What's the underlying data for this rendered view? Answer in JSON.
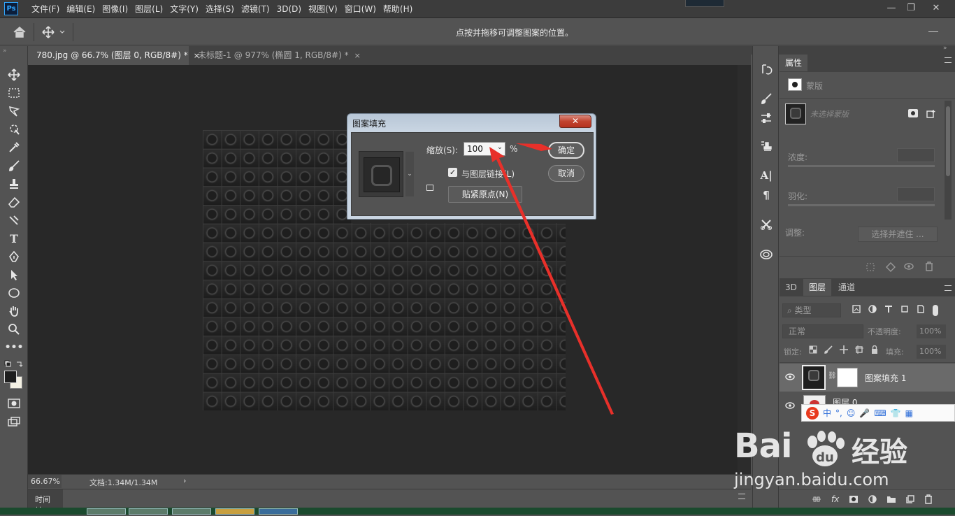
{
  "app": {
    "logo": "Ps"
  },
  "menu": [
    "文件(F)",
    "编辑(E)",
    "图像(I)",
    "图层(L)",
    "文字(Y)",
    "选择(S)",
    "滤镜(T)",
    "3D(D)",
    "视图(V)",
    "窗口(W)",
    "帮助(H)"
  ],
  "window_controls": {
    "minimize": "—",
    "restore": "❐",
    "close": "✕"
  },
  "options_bar": {
    "hint": "点按并拖移可调整图案的位置。"
  },
  "tabs": [
    {
      "label": "780.jpg @ 66.7% (图层 0, RGB/8#) *",
      "close": "×"
    },
    {
      "label": "未标题-1 @ 977% (椭圆 1, RGB/8#) *",
      "close": "×"
    }
  ],
  "status": {
    "zoom": "66.67%",
    "doc": "文档:1.34M/1.34M",
    "arrow": "›"
  },
  "timeline": {
    "label": "时间轴"
  },
  "dialog": {
    "title": "图案填充",
    "close": "✕",
    "scale_label": "缩放(S):",
    "scale_value": "100",
    "percent": "%",
    "link_label": "与图层链接(L)",
    "link_checked": "✓",
    "snap_button": "贴紧原点(N)",
    "ok": "确定",
    "cancel": "取消"
  },
  "properties": {
    "tab": "属性",
    "mask_label": "蒙版",
    "no_mask": "未选择蒙版",
    "density": "浓度:",
    "feather": "羽化:",
    "adjust": "调整:",
    "select_mask_button": "选择并遮住 ..."
  },
  "layers_panel": {
    "tabs": [
      "3D",
      "图层",
      "通道"
    ],
    "kind": "类型",
    "blend_mode": "正常",
    "opacity_label": "不透明度:",
    "opacity_value": "100%",
    "lock_label": "锁定:",
    "fill_label": "填充:",
    "fill_value": "100%",
    "layers": [
      {
        "name": "图案填充 1"
      },
      {
        "name": "图层 0"
      }
    ]
  },
  "ime": {
    "mode": "中",
    "punct": "°,"
  },
  "watermark": {
    "brand": "Bai",
    "brand2": "经验",
    "url": "jingyan.baidu.com"
  },
  "colors": {
    "accent": "#31a8ff",
    "arrow": "#e8302a",
    "dialog_close": "#c2432f"
  },
  "icons": [
    "home-icon",
    "move-tool-icon",
    "marquee-icon",
    "lasso-icon",
    "quick-select-icon",
    "crop-icon",
    "eyedropper-icon",
    "brush-icon",
    "stamp-icon",
    "eraser-icon",
    "text-tool-icon",
    "pen-icon",
    "path-select-icon",
    "ellipse-icon",
    "hand-icon",
    "zoom-icon",
    "more-icon"
  ]
}
